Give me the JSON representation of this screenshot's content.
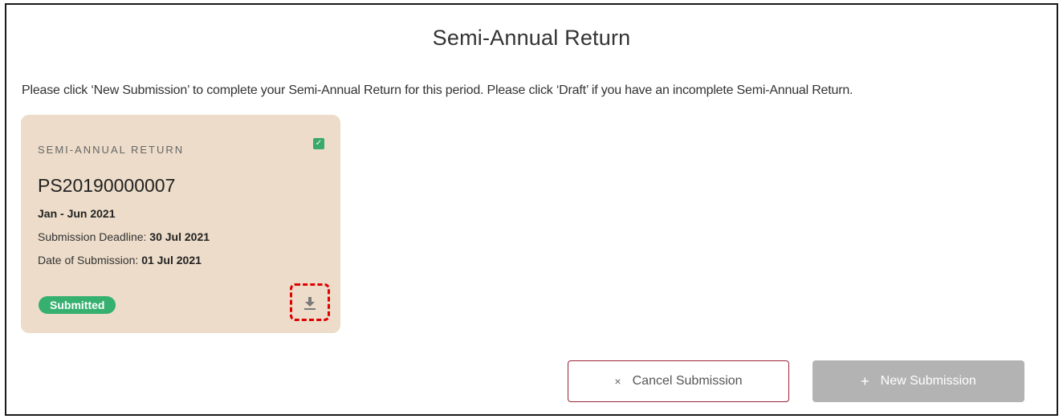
{
  "page": {
    "title": "Semi-Annual Return",
    "instructions": "Please click ‘New Submission’ to complete your Semi-Annual Return for this period. Please click ‘Draft’ if you have an incomplete Semi-Annual Return."
  },
  "card": {
    "type_label": "SEMI-ANNUAL RETURN",
    "reference": "PS20190000007",
    "period": "Jan - Jun 2021",
    "deadline_label": "Submission Deadline:",
    "deadline_value": "30 Jul 2021",
    "submission_label": "Date of Submission:",
    "submission_value": "01 Jul 2021",
    "status": "Submitted",
    "checked": true,
    "check_icon": "check-icon",
    "download_icon": "download-icon"
  },
  "actions": {
    "cancel_glyph": "×",
    "cancel_label": "Cancel Submission",
    "new_glyph": "+",
    "new_label": "New Submission"
  },
  "colors": {
    "card_bg": "#ecdcc9",
    "status_green": "#35b06e",
    "cancel_border": "#9b2236",
    "new_button_bg": "#b3b3b3",
    "highlight_red": "#e00000"
  }
}
